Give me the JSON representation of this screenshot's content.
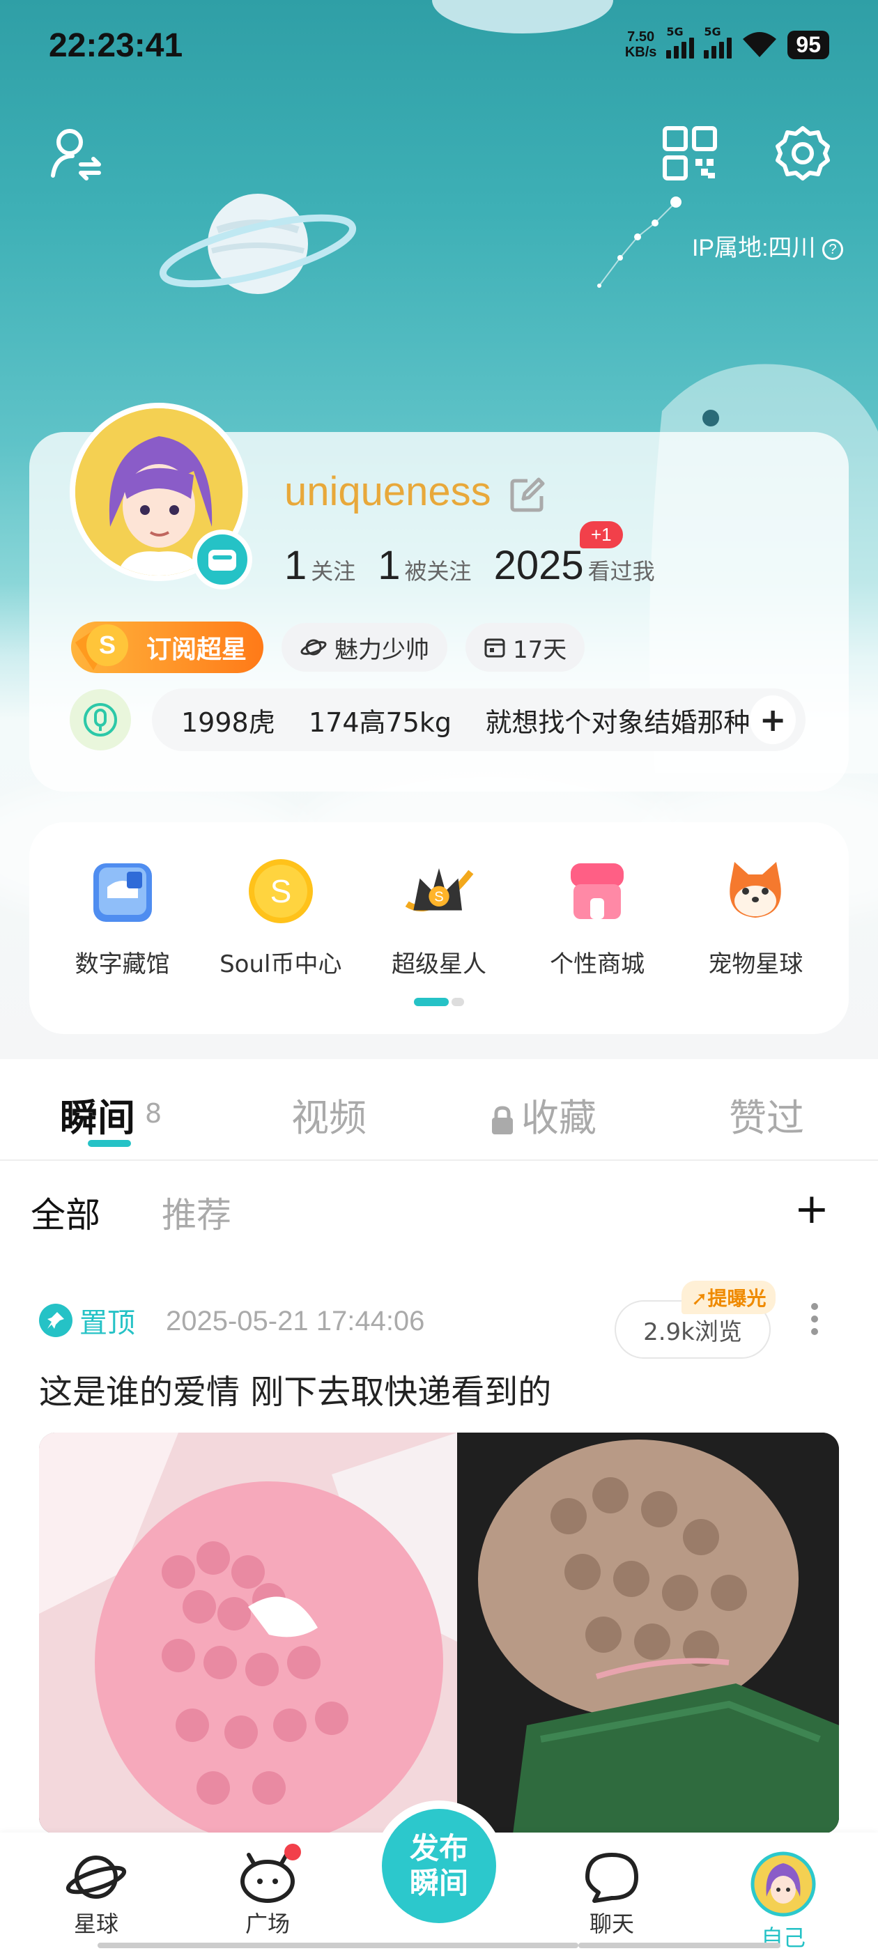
{
  "status": {
    "time": "22:23:41",
    "net_speed_value": "7.50",
    "net_speed_unit": "KB/s",
    "sim1": "5G",
    "sim2": "5G",
    "battery": "95"
  },
  "header": {
    "ip_location": "IP属地:四川"
  },
  "profile": {
    "username": "uniqueness",
    "following_count": "1",
    "following_label": "关注",
    "followers_count": "1",
    "followers_label": "被关注",
    "visitors_count": "2025",
    "visitors_label": "看过我",
    "visitors_new": "+1",
    "vip_label": "订阅超星",
    "tag_charm": "魅力少帅",
    "tag_days": "17天",
    "bio": "1998虎    174高75kg    就想找个对象结婚那种"
  },
  "quick_menu": [
    {
      "label": "数字藏馆",
      "icon": "digital-museum-icon"
    },
    {
      "label": "Soul币中心",
      "icon": "soul-coin-icon"
    },
    {
      "label": "超级星人",
      "icon": "super-star-icon"
    },
    {
      "label": "个性商城",
      "icon": "store-icon"
    },
    {
      "label": "宠物星球",
      "icon": "pet-planet-icon"
    }
  ],
  "tabs": {
    "moments": "瞬间",
    "moments_count": "8",
    "video": "视频",
    "favorites": "收藏",
    "liked": "赞过"
  },
  "subtabs": {
    "all": "全部",
    "recommended": "推荐",
    "add": "+"
  },
  "post": {
    "pinned_label": "置顶",
    "timestamp": "2025-05-21 17:44:06",
    "boost_label": "提曝光",
    "views": "2.9k浏览",
    "title": "这是谁的爱情 刚下去取快递看到的"
  },
  "bottom_nav": {
    "planet": "星球",
    "square": "广场",
    "publish": "发布瞬间",
    "chat": "聊天",
    "me": "自己"
  },
  "colors": {
    "accent": "#25c2c6",
    "username": "#e8a83a",
    "badge_red": "#f2404a",
    "boost": "#ef8a00"
  }
}
